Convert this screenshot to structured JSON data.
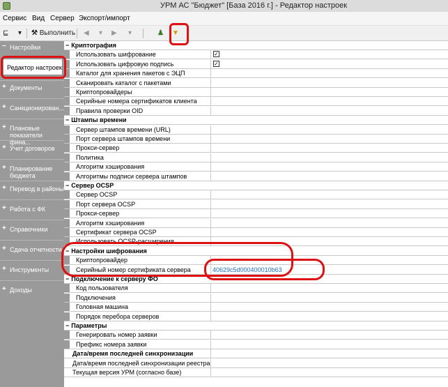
{
  "window": {
    "title": "УРМ АС \"Бюджет\" [База 2016 г.] - Редактор настроек"
  },
  "menu": [
    "Сервис",
    "Вид",
    "Сервер",
    "Экспорт/импорт"
  ],
  "toolbar": {
    "execute_label": "Выполнить"
  },
  "sidebar": {
    "top_label": "Настройки",
    "selected_label": "Редактор настроек",
    "items": [
      "Документы",
      "Санкционирован...",
      "Плановые\nпоказатели фина...",
      "Учет договоров",
      "Планирование\nбюджета",
      "Перевод в районы",
      "Работа с ФК",
      "Справочники",
      "Сдача отчетности",
      "Инструменты",
      "Доходы"
    ]
  },
  "settings": {
    "rows": [
      {
        "kind": "category",
        "label": "Криптография"
      },
      {
        "kind": "setting",
        "label": "Использовать шифрование",
        "checkbox": true
      },
      {
        "kind": "setting",
        "label": "Использовать цифровую подпись",
        "checkbox": true
      },
      {
        "kind": "setting",
        "label": "Каталог для хранения пакетов с ЭЦП"
      },
      {
        "kind": "setting",
        "label": "Сканировать каталог с пакетами"
      },
      {
        "kind": "setting",
        "label": "Криптопровайдеры"
      },
      {
        "kind": "setting",
        "label": "Серийные номера сертификатов клиента"
      },
      {
        "kind": "setting",
        "label": "Правила проверки OID"
      },
      {
        "kind": "category",
        "label": "Штампы времени"
      },
      {
        "kind": "setting",
        "label": "Сервер штампов времени (URL)"
      },
      {
        "kind": "setting",
        "label": "Порт сервера штампов времени"
      },
      {
        "kind": "setting",
        "label": "Прокси-сервер"
      },
      {
        "kind": "setting",
        "label": "Политика"
      },
      {
        "kind": "setting",
        "label": "Алгоритм хэширования"
      },
      {
        "kind": "setting",
        "label": "Алгоритмы подписи сервера штампов"
      },
      {
        "kind": "category",
        "label": "Сервер OCSP"
      },
      {
        "kind": "setting",
        "label": "Сервер OCSP"
      },
      {
        "kind": "setting",
        "label": "Порт сервера OCSP"
      },
      {
        "kind": "setting",
        "label": "Прокси-сервер"
      },
      {
        "kind": "setting",
        "label": "Алгоритм хэширования"
      },
      {
        "kind": "setting",
        "label": "Сертификат сервера OCSP"
      },
      {
        "kind": "setting",
        "label": "Использовать OCSP-расширения"
      },
      {
        "kind": "category",
        "label": "Настройки шифрования"
      },
      {
        "kind": "setting",
        "label": "Криптопровайдер"
      },
      {
        "kind": "setting",
        "label": "Серийный номер сертификата сервера",
        "value": "40629c5d000400010b63"
      },
      {
        "kind": "category",
        "label": "Подключение к серверу ФО"
      },
      {
        "kind": "setting",
        "label": "Код пользователя"
      },
      {
        "kind": "setting",
        "label": "Подключения"
      },
      {
        "kind": "setting",
        "label": "Головная машина"
      },
      {
        "kind": "setting",
        "label": "Порядок перебора серверов"
      },
      {
        "kind": "category",
        "label": "Параметры"
      },
      {
        "kind": "setting",
        "label": "Генерировать номер заявки"
      },
      {
        "kind": "setting",
        "label": "Префикс номера заявки"
      },
      {
        "kind": "plain-bold",
        "label": "Дата/время последней синхронизации"
      },
      {
        "kind": "plain",
        "label": "Дата/время последней синхронизации реестра"
      },
      {
        "kind": "plain",
        "label": "Текущая версия УРМ (согласно базе)"
      }
    ]
  }
}
